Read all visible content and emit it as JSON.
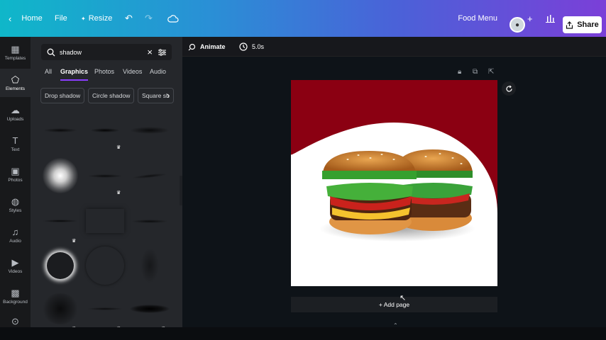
{
  "topbar": {
    "back_icon": "chevron-left-icon",
    "home_label": "Home",
    "file_label": "File",
    "resize_label": "Resize",
    "resize_icon": "sparkle-icon",
    "undo_icon": "undo-icon",
    "redo_icon": "redo-icon",
    "cloud_icon": "cloud-check-icon",
    "design_title": "Food Menu",
    "add_collaborator_icon": "plus-icon",
    "insights_icon": "bar-chart-icon",
    "share_label": "Share",
    "share_icon": "share-icon",
    "gradient_colors": [
      "#0fb7c9",
      "#4a62d8",
      "#7b3fd8"
    ]
  },
  "rail": {
    "items": [
      {
        "label": "Templates",
        "icon": "templates-icon"
      },
      {
        "label": "Elements",
        "icon": "elements-icon"
      },
      {
        "label": "Uploads",
        "icon": "upload-icon"
      },
      {
        "label": "Text",
        "icon": "text-icon"
      },
      {
        "label": "Photos",
        "icon": "photos-icon"
      },
      {
        "label": "Styles",
        "icon": "palette-icon"
      },
      {
        "label": "Audio",
        "icon": "music-icon"
      },
      {
        "label": "Videos",
        "icon": "video-icon"
      },
      {
        "label": "Background",
        "icon": "background-icon"
      },
      {
        "label": "",
        "icon": "apps-icon"
      }
    ]
  },
  "panel": {
    "search_value": "shadow",
    "categories": [
      "All",
      "Graphics",
      "Photos",
      "Videos",
      "Audio"
    ],
    "active_category": "Graphics",
    "chips": [
      "Drop shadow",
      "Circle shadow",
      "Square sh"
    ],
    "accent": "#8b3dff"
  },
  "editor_toolbar": {
    "animate_label": "Animate",
    "duration_label": "5.0s"
  },
  "page": {
    "background_color": "#8b0012",
    "image_subject": "double-burger-image"
  },
  "canvas": {
    "add_page_label": "+ Add page"
  }
}
